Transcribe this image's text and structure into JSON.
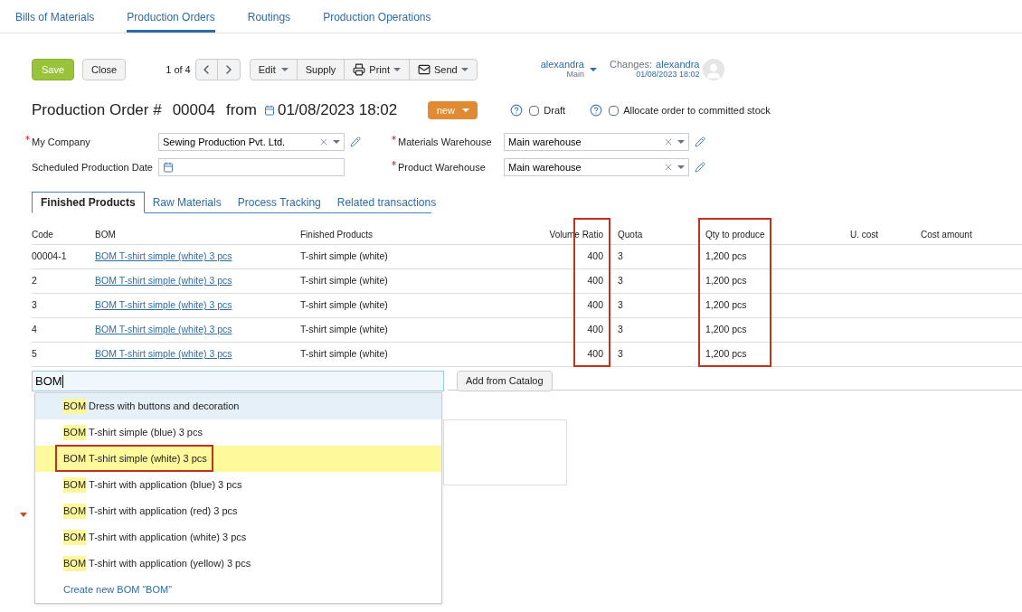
{
  "nav_tabs": [
    {
      "label": "Bills of Materials",
      "selected": false
    },
    {
      "label": "Production Orders",
      "selected": true
    },
    {
      "label": "Routings",
      "selected": false
    },
    {
      "label": "Production Operations",
      "selected": false
    }
  ],
  "toolbar": {
    "save": "Save",
    "close": "Close",
    "pager": "1 of 4",
    "edit": "Edit",
    "supply": "Supply",
    "print": "Print",
    "send": "Send"
  },
  "user": {
    "name": "alexandra",
    "branch": "Main",
    "changes_label": "Changes:",
    "changes_user": "alexandra",
    "changes_time": "01/08/2023 18:02"
  },
  "header": {
    "title": "Production Order #",
    "number": "00004",
    "from": "from",
    "date": "01/08/2023 18:02",
    "status": "new",
    "draft": {
      "label": "Draft",
      "checked": false
    },
    "allocate": {
      "label": "Allocate order to committed stock",
      "checked": false
    }
  },
  "fields_left": [
    {
      "label": "My Company",
      "required": true,
      "kind": "select",
      "value": "Sewing Production Pvt. Ltd."
    },
    {
      "label": "Scheduled Production Date",
      "required": false,
      "kind": "date"
    }
  ],
  "fields_right": [
    {
      "label": "Materials Warehouse",
      "required": true,
      "kind": "select",
      "value": "Main warehouse"
    },
    {
      "label": "Product Warehouse",
      "required": true,
      "kind": "select",
      "value": "Main warehouse"
    }
  ],
  "doc_tabs": [
    {
      "label": "Finished Products",
      "selected": true
    },
    {
      "label": "Raw Materials",
      "selected": false
    },
    {
      "label": "Process Tracking",
      "selected": false
    },
    {
      "label": "Related transactions",
      "selected": false
    }
  ],
  "table": {
    "columns": [
      "Code",
      "BOM",
      "Finished Products",
      "Volume Ratio",
      "Quota",
      "Qty to produce",
      "U. cost",
      "Cost amount"
    ],
    "rows": [
      [
        "00004-1",
        "BOM T-shirt simple (white) 3 pcs",
        "T-shirt simple (white)",
        "400",
        "3",
        "1,200 pcs"
      ],
      [
        "2",
        "BOM T-shirt simple (white) 3 pcs",
        "T-shirt simple (white)",
        "400",
        "3",
        "1,200 pcs"
      ],
      [
        "3",
        "BOM T-shirt simple (white) 3 pcs",
        "T-shirt simple (white)",
        "400",
        "3",
        "1,200 pcs"
      ],
      [
        "4",
        "BOM T-shirt simple (white) 3 pcs",
        "T-shirt simple (white)",
        "400",
        "3",
        "1,200 pcs"
      ],
      [
        "5",
        "BOM T-shirt simple (white) 3 pcs",
        "T-shirt simple (white)",
        "400",
        "3",
        "1,200 pcs"
      ]
    ]
  },
  "search": {
    "value": "BOM",
    "add_button": "Add from Catalog"
  },
  "suggestions": [
    {
      "match": "BOM",
      "rest": "Dress with buttons and decoration",
      "hovered": true,
      "selected": false
    },
    {
      "match": "BOM",
      "rest": "T-shirt simple (blue) 3 pcs",
      "hovered": false,
      "selected": false
    },
    {
      "match": "BOM",
      "rest": "T-shirt simple (white) 3 pcs",
      "hovered": false,
      "selected": true
    },
    {
      "match": "BOM",
      "rest": "T-shirt with application (blue) 3 pcs",
      "hovered": false,
      "selected": false
    },
    {
      "match": "BOM",
      "rest": "T-shirt with application (red) 3 pcs",
      "hovered": false,
      "selected": false
    },
    {
      "match": "BOM",
      "rest": "T-shirt with application (white) 3 pcs",
      "hovered": false,
      "selected": false
    },
    {
      "match": "BOM",
      "rest": "T-shirt with application (yellow) 3 pcs",
      "hovered": false,
      "selected": false
    }
  ],
  "create_new": "Create new BOM “BOM”"
}
